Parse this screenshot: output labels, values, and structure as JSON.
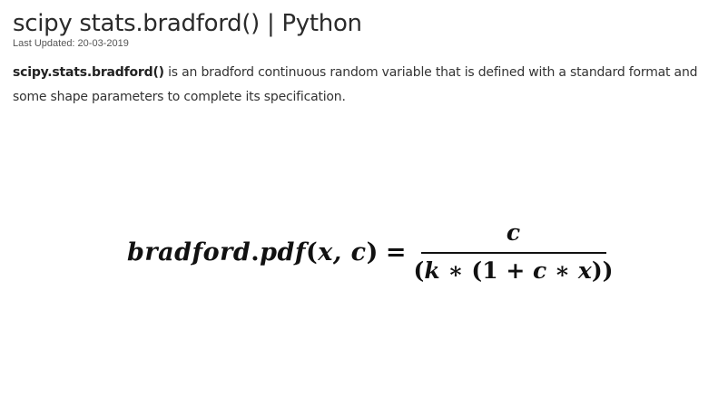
{
  "article": {
    "title": "scipy stats.bradford() | Python",
    "last_updated": "Last Updated: 20-03-2019",
    "intro": {
      "function_name": "scipy.stats.bradford()",
      "text": " is an bradford continuous random variable that is defined with a standard format and some shape parameters to complete its specification."
    }
  },
  "formula": {
    "lhs_name": "bradford",
    "lhs_dot": ".",
    "lhs_method": "pdf",
    "lhs_open": "(",
    "lhs_args": "x, c",
    "lhs_close": ")",
    "equals": "=",
    "numerator": "c",
    "denominator_open": "(",
    "denominator_k": "k",
    "denominator_op1": " ∗ (",
    "denominator_one": "1",
    "denominator_plus": " + ",
    "denominator_c": "c",
    "denominator_op2": " ∗ ",
    "denominator_x": "x",
    "denominator_close": "))"
  }
}
